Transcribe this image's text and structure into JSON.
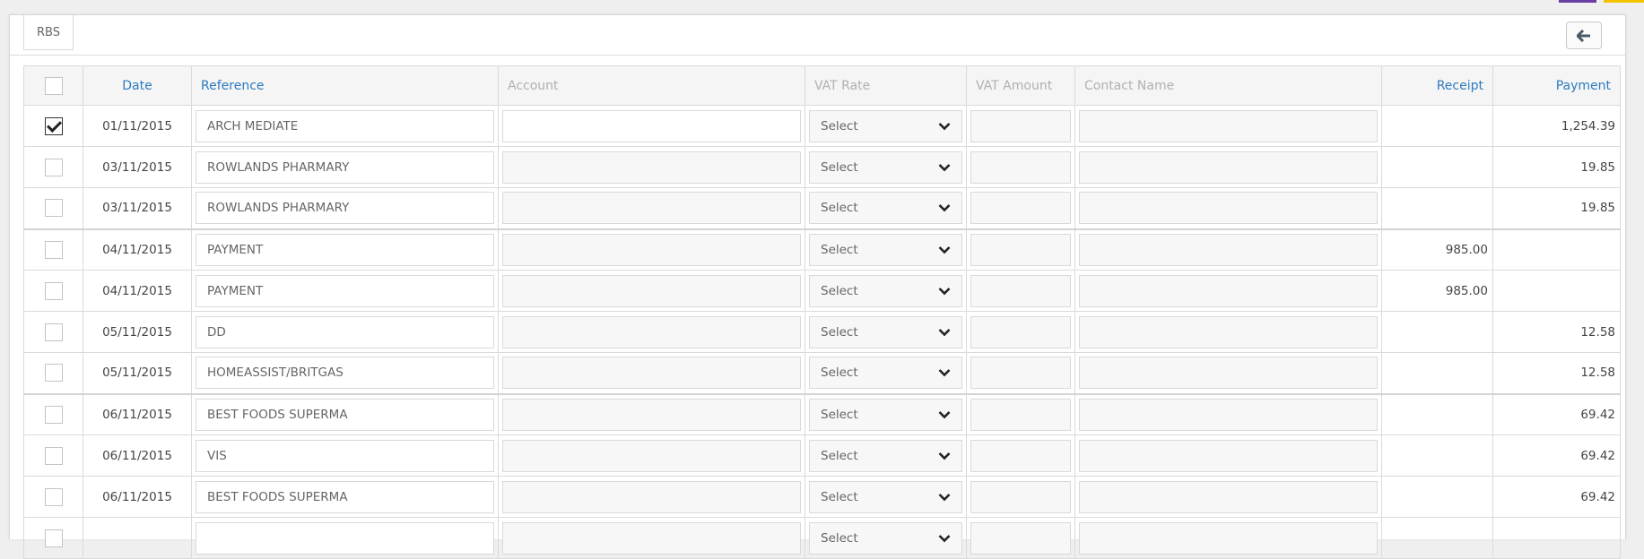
{
  "tab": {
    "label": "RBS"
  },
  "columns": {
    "date": "Date",
    "reference": "Reference",
    "account": "Account",
    "vat_rate": "VAT Rate",
    "vat_amount": "VAT Amount",
    "contact_name": "Contact Name",
    "receipt": "Receipt",
    "payment": "Payment"
  },
  "select_placeholder": "Select",
  "rows": [
    {
      "checked": true,
      "date": "01/11/2015",
      "reference": "ARCH MEDIATE",
      "receipt": "",
      "payment": "1,254.39"
    },
    {
      "checked": false,
      "date": "03/11/2015",
      "reference": "ROWLANDS PHARMARY",
      "receipt": "",
      "payment": "19.85"
    },
    {
      "checked": false,
      "date": "03/11/2015",
      "reference": "ROWLANDS PHARMARY",
      "receipt": "",
      "payment": "19.85"
    },
    {
      "checked": false,
      "date": "04/11/2015",
      "reference": "PAYMENT",
      "receipt": "985.00",
      "payment": ""
    },
    {
      "checked": false,
      "date": "04/11/2015",
      "reference": "PAYMENT",
      "receipt": "985.00",
      "payment": ""
    },
    {
      "checked": false,
      "date": "05/11/2015",
      "reference": "DD",
      "receipt": "",
      "payment": "12.58"
    },
    {
      "checked": false,
      "date": "05/11/2015",
      "reference": "HOMEASSIST/BRITGAS",
      "receipt": "",
      "payment": "12.58"
    },
    {
      "checked": false,
      "date": "06/11/2015",
      "reference": "BEST FOODS SUPERMA",
      "receipt": "",
      "payment": "69.42"
    },
    {
      "checked": false,
      "date": "06/11/2015",
      "reference": "VIS",
      "receipt": "",
      "payment": "69.42"
    },
    {
      "checked": false,
      "date": "06/11/2015",
      "reference": "BEST FOODS SUPERMA",
      "receipt": "",
      "payment": "69.42"
    },
    {
      "checked": false,
      "date": "",
      "reference": "",
      "receipt": "",
      "payment": ""
    }
  ],
  "icons": {
    "back": "arrow-left-icon",
    "dropdown": "chevron-down-icon",
    "check": "checkmark-icon"
  },
  "colors": {
    "sort_link": "#2d7bbf",
    "corner_a": "#6a3fa3",
    "corner_b": "#f4c300"
  }
}
